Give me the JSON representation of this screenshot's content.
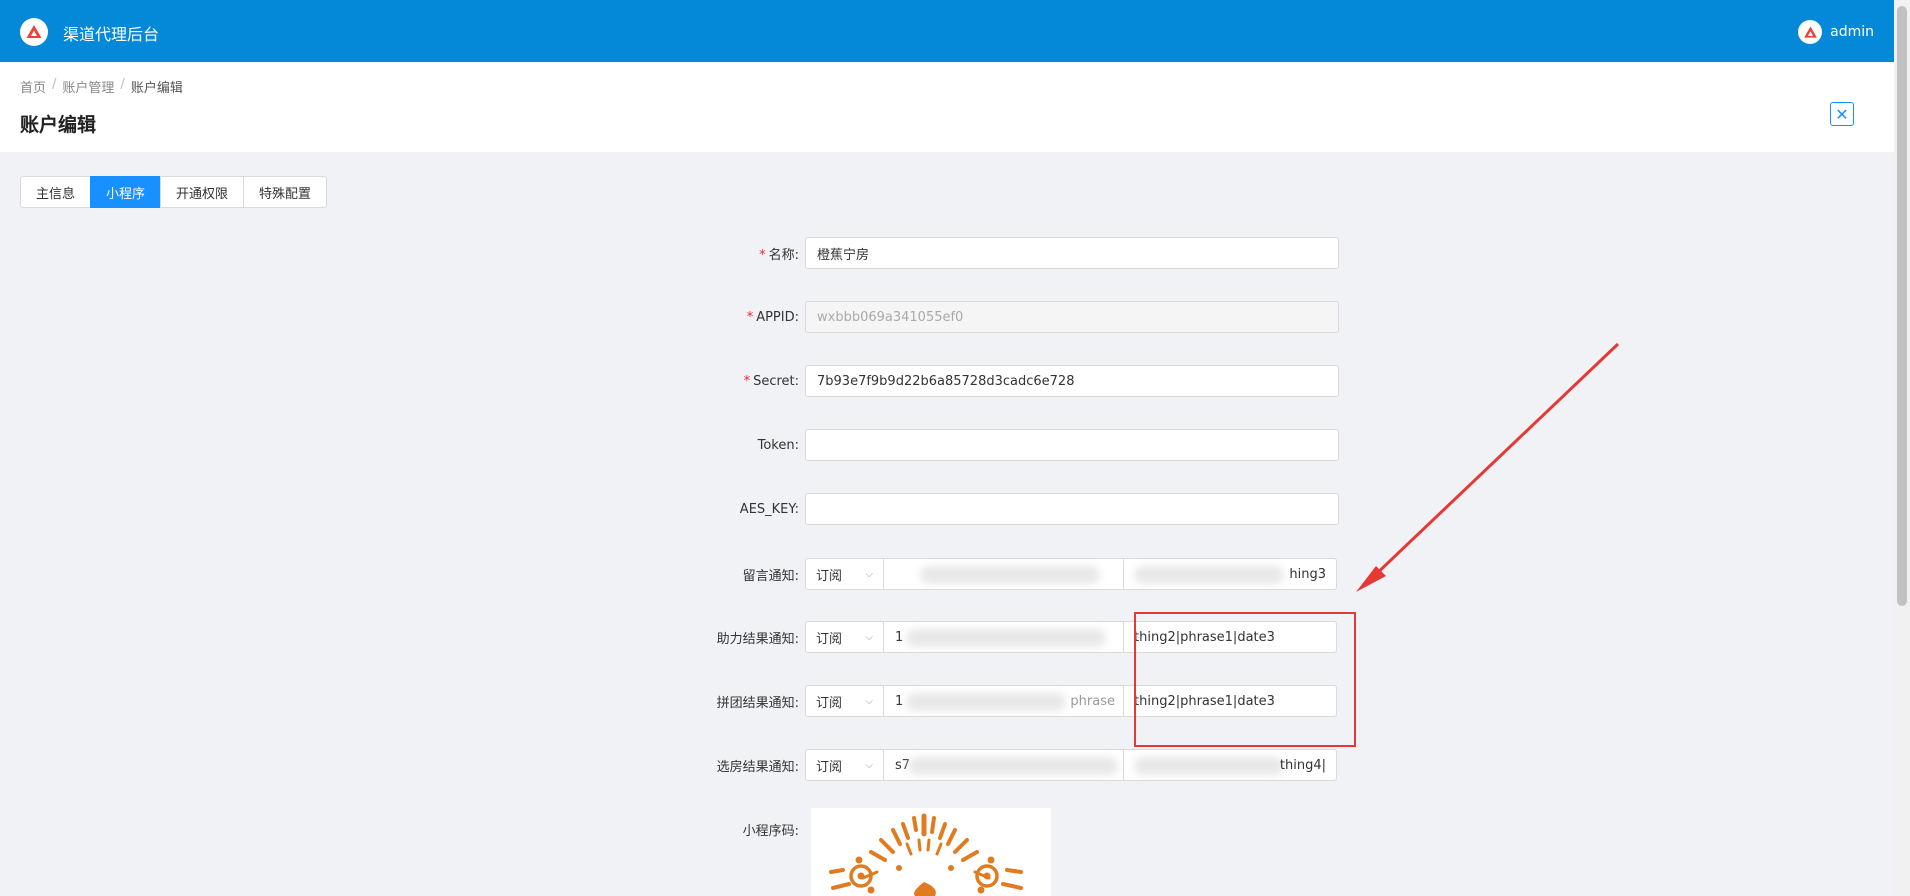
{
  "header": {
    "app_title": "渠道代理后台",
    "user_name": "admin"
  },
  "breadcrumb": {
    "home": "首页",
    "section": "账户管理",
    "current": "账户编辑",
    "separator": "/"
  },
  "page": {
    "title": "账户编辑",
    "close_glyph": "✕"
  },
  "tabs": [
    {
      "label": "主信息",
      "active": false
    },
    {
      "label": "小程序",
      "active": true
    },
    {
      "label": "开通权限",
      "active": false
    },
    {
      "label": "特殊配置",
      "active": false
    }
  ],
  "form": {
    "name": {
      "label": "名称:",
      "required": true,
      "value": "橙蕉宁房"
    },
    "appid": {
      "label": "APPID:",
      "required": true,
      "value": "wxbbb069a341055ef0",
      "disabled": true
    },
    "secret": {
      "label": "Secret:",
      "required": true,
      "value": "7b93e7f9b9d22b6a85728d3cadc6e728"
    },
    "token": {
      "label": "Token:",
      "required": false,
      "value": ""
    },
    "aes_key": {
      "label": "AES_KEY:",
      "required": false,
      "value": ""
    },
    "notify_message": {
      "label": "留言通知:",
      "type": "订阅",
      "template": "",
      "fields": "hing3"
    },
    "notify_assist": {
      "label": "助力结果通知:",
      "type": "订阅",
      "template": "1",
      "fields": "thing2|phrase1|date3"
    },
    "notify_group": {
      "label": "拼团结果通知:",
      "type": "订阅",
      "template": "1",
      "template_tail": "phrase",
      "fields": "thing2|phrase1|date3"
    },
    "notify_room": {
      "label": "选房结果通知:",
      "type": "订阅",
      "template": "s7",
      "fields": "thing4|"
    },
    "qrcode": {
      "label": "小程序码:"
    }
  },
  "icons": {
    "logo": "brand-a-icon",
    "user": "brand-a-icon",
    "dropdown": "chevron-down-icon"
  },
  "colors": {
    "header": "#0488d8",
    "primary": "#1890ff",
    "annotation": "#e53935",
    "qr": "#e07b20"
  }
}
